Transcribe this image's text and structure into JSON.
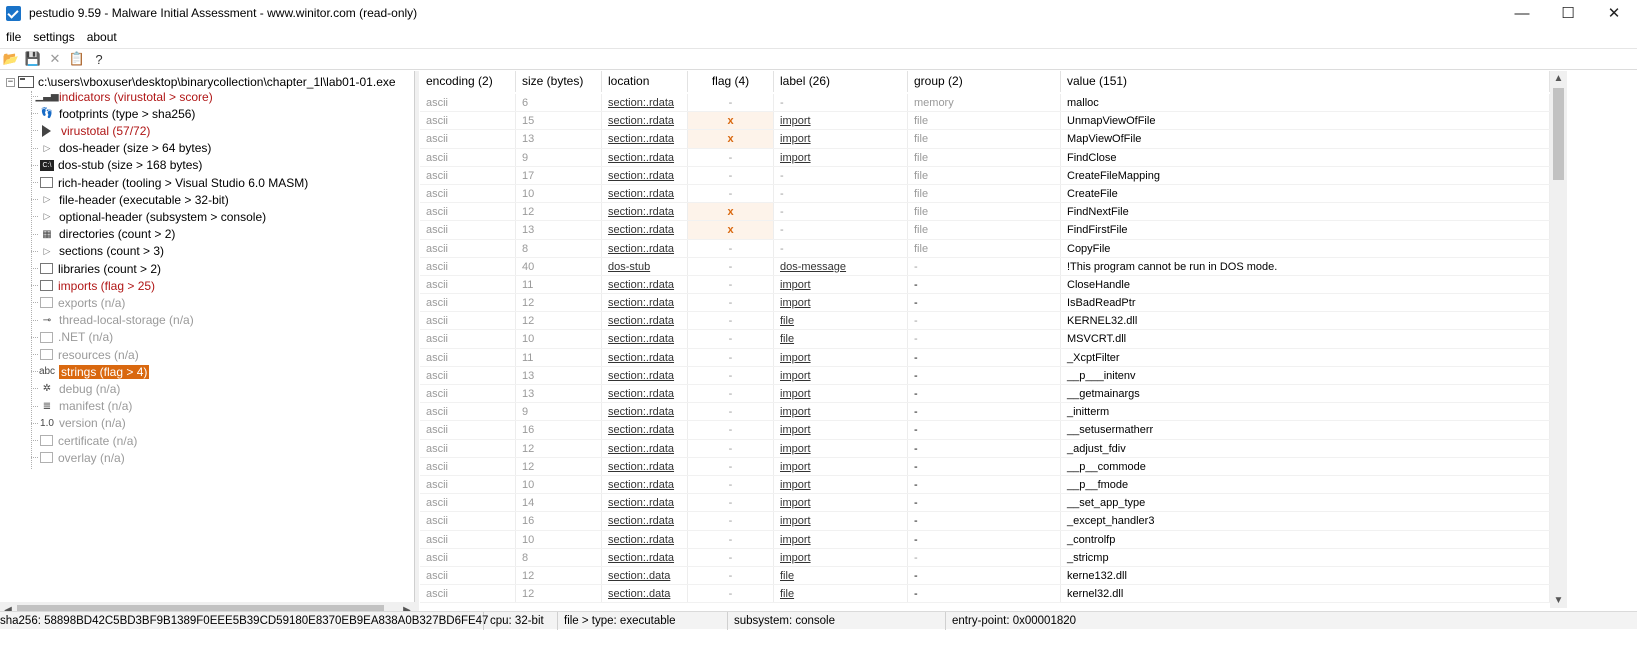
{
  "window": {
    "title": "pestudio 9.59 - Malware Initial Assessment - www.winitor.com (read-only)",
    "minimize": "—",
    "maximize": "☐",
    "close": "✕"
  },
  "menu": [
    "file",
    "settings",
    "about"
  ],
  "toolbar": {
    "open": "📂",
    "save": "💾",
    "close": "✕",
    "copy": "📋",
    "help": "?"
  },
  "tree": {
    "root_expander": "−",
    "root": "c:\\users\\vboxuser\\desktop\\binarycollection\\chapter_1l\\lab01-01.exe",
    "items": [
      {
        "label": "indicators (virustotal > score)",
        "style": "red",
        "icon": "bars-icon",
        "glyph": "▁▃▅"
      },
      {
        "label": "footprints (type > sha256)",
        "style": "normal",
        "icon": "footprints-icon",
        "glyph": "👣"
      },
      {
        "label": "virustotal (57/72)",
        "style": "red",
        "icon": "virustotal-icon",
        "glyph": ""
      },
      {
        "label": "dos-header (size > 64 bytes)",
        "style": "normal",
        "icon": "arrow-icon",
        "glyph": "▷"
      },
      {
        "label": "dos-stub (size > 168 bytes)",
        "style": "normal",
        "icon": "console-icon",
        "glyph": "C:\\"
      },
      {
        "label": "rich-header (tooling > Visual Studio 6.0 MASM)",
        "style": "normal",
        "icon": "rich-icon",
        "glyph": ""
      },
      {
        "label": "file-header (executable > 32-bit)",
        "style": "normal",
        "icon": "arrow-icon",
        "glyph": "▷"
      },
      {
        "label": "optional-header (subsystem > console)",
        "style": "normal",
        "icon": "arrow-icon",
        "glyph": "▷"
      },
      {
        "label": "directories (count > 2)",
        "style": "normal",
        "icon": "directories-icon",
        "glyph": "▦"
      },
      {
        "label": "sections (count > 3)",
        "style": "normal",
        "icon": "arrow-icon",
        "glyph": "▷"
      },
      {
        "label": "libraries (count > 2)",
        "style": "normal",
        "icon": "libraries-icon",
        "glyph": ""
      },
      {
        "label": "imports (flag > 25)",
        "style": "red",
        "icon": "imports-icon",
        "glyph": ""
      },
      {
        "label": "exports (n/a)",
        "style": "grey",
        "icon": "exports-icon",
        "glyph": ""
      },
      {
        "label": "thread-local-storage (n/a)",
        "style": "grey",
        "icon": "tls-icon",
        "glyph": "⊸"
      },
      {
        "label": ".NET (n/a)",
        "style": "grey",
        "icon": "dotnet-icon",
        "glyph": ""
      },
      {
        "label": "resources (n/a)",
        "style": "grey",
        "icon": "resources-icon",
        "glyph": ""
      },
      {
        "label": "strings (flag > 4)",
        "style": "selected",
        "icon": "strings-icon",
        "glyph": "abc"
      },
      {
        "label": "debug (n/a)",
        "style": "grey",
        "icon": "bug-icon",
        "glyph": "✲"
      },
      {
        "label": "manifest (n/a)",
        "style": "grey",
        "icon": "manifest-icon",
        "glyph": "≣"
      },
      {
        "label": "version (n/a)",
        "style": "grey",
        "icon": "version-icon",
        "glyph": "1.0"
      },
      {
        "label": "certificate (n/a)",
        "style": "grey",
        "icon": "certificate-icon",
        "glyph": ""
      },
      {
        "label": "overlay (n/a)",
        "style": "grey",
        "icon": "overlay-icon",
        "glyph": ""
      }
    ]
  },
  "table": {
    "headers": {
      "encoding": "encoding (2)",
      "size": "size (bytes)",
      "location": "location",
      "flag": "flag (4)",
      "label": "label (26)",
      "group": "group (2)",
      "value": "value (151)"
    },
    "rows": [
      {
        "encoding": "ascii",
        "size": "6",
        "location": "section:.rdata",
        "flag": "-",
        "label": "-",
        "group": "memory",
        "value": "malloc"
      },
      {
        "encoding": "ascii",
        "size": "15",
        "location": "section:.rdata",
        "flag": "x",
        "label": "import",
        "group": "file",
        "value": "UnmapViewOfFile"
      },
      {
        "encoding": "ascii",
        "size": "13",
        "location": "section:.rdata",
        "flag": "x",
        "label": "import",
        "group": "file",
        "value": "MapViewOfFile"
      },
      {
        "encoding": "ascii",
        "size": "9",
        "location": "section:.rdata",
        "flag": "-",
        "label": "import",
        "group": "file",
        "value": "FindClose"
      },
      {
        "encoding": "ascii",
        "size": "17",
        "location": "section:.rdata",
        "flag": "-",
        "label": "-",
        "group": "file",
        "value": "CreateFileMapping"
      },
      {
        "encoding": "ascii",
        "size": "10",
        "location": "section:.rdata",
        "flag": "-",
        "label": "-",
        "group": "file",
        "value": "CreateFile"
      },
      {
        "encoding": "ascii",
        "size": "12",
        "location": "section:.rdata",
        "flag": "x",
        "label": "-",
        "group": "file",
        "value": "FindNextFile"
      },
      {
        "encoding": "ascii",
        "size": "13",
        "location": "section:.rdata",
        "flag": "x",
        "label": "-",
        "group": "file",
        "value": "FindFirstFile"
      },
      {
        "encoding": "ascii",
        "size": "8",
        "location": "section:.rdata",
        "flag": "-",
        "label": "-",
        "group": "file",
        "value": "CopyFile"
      },
      {
        "encoding": "ascii",
        "size": "40",
        "location": "dos-stub",
        "flag": "-",
        "label": "dos-message",
        "group": "-",
        "value": "!This program cannot be run in DOS mode."
      },
      {
        "encoding": "ascii",
        "size": "11",
        "location": "section:.rdata",
        "flag": "-",
        "label": "import",
        "group": "-",
        "value": "CloseHandle"
      },
      {
        "encoding": "ascii",
        "size": "12",
        "location": "section:.rdata",
        "flag": "-",
        "label": "import",
        "group": "-",
        "value": "IsBadReadPtr"
      },
      {
        "encoding": "ascii",
        "size": "12",
        "location": "section:.rdata",
        "flag": "-",
        "label": "file",
        "group": "-",
        "value": "KERNEL32.dll"
      },
      {
        "encoding": "ascii",
        "size": "10",
        "location": "section:.rdata",
        "flag": "-",
        "label": "file",
        "group": "-",
        "value": "MSVCRT.dll"
      },
      {
        "encoding": "ascii",
        "size": "11",
        "location": "section:.rdata",
        "flag": "-",
        "label": "import",
        "group": "-",
        "value": "_XcptFilter"
      },
      {
        "encoding": "ascii",
        "size": "13",
        "location": "section:.rdata",
        "flag": "-",
        "label": "import",
        "group": "-",
        "value": "__p___initenv"
      },
      {
        "encoding": "ascii",
        "size": "13",
        "location": "section:.rdata",
        "flag": "-",
        "label": "import",
        "group": "-",
        "value": "__getmainargs"
      },
      {
        "encoding": "ascii",
        "size": "9",
        "location": "section:.rdata",
        "flag": "-",
        "label": "import",
        "group": "-",
        "value": "_initterm"
      },
      {
        "encoding": "ascii",
        "size": "16",
        "location": "section:.rdata",
        "flag": "-",
        "label": "import",
        "group": "-",
        "value": "__setusermatherr"
      },
      {
        "encoding": "ascii",
        "size": "12",
        "location": "section:.rdata",
        "flag": "-",
        "label": "import",
        "group": "-",
        "value": "_adjust_fdiv"
      },
      {
        "encoding": "ascii",
        "size": "12",
        "location": "section:.rdata",
        "flag": "-",
        "label": "import",
        "group": "-",
        "value": "__p__commode"
      },
      {
        "encoding": "ascii",
        "size": "10",
        "location": "section:.rdata",
        "flag": "-",
        "label": "import",
        "group": "-",
        "value": "__p__fmode"
      },
      {
        "encoding": "ascii",
        "size": "14",
        "location": "section:.rdata",
        "flag": "-",
        "label": "import",
        "group": "-",
        "value": "__set_app_type"
      },
      {
        "encoding": "ascii",
        "size": "16",
        "location": "section:.rdata",
        "flag": "-",
        "label": "import",
        "group": "-",
        "value": "_except_handler3"
      },
      {
        "encoding": "ascii",
        "size": "10",
        "location": "section:.rdata",
        "flag": "-",
        "label": "import",
        "group": "-",
        "value": "_controlfp"
      },
      {
        "encoding": "ascii",
        "size": "8",
        "location": "section:.rdata",
        "flag": "-",
        "label": "import",
        "group": "-",
        "value": "_stricmp"
      },
      {
        "encoding": "ascii",
        "size": "12",
        "location": "section:.data",
        "flag": "-",
        "label": "file",
        "group": "-",
        "value": "kerne132.dll"
      },
      {
        "encoding": "ascii",
        "size": "12",
        "location": "section:.data",
        "flag": "-",
        "label": "file",
        "group": "-",
        "value": "kernel32.dll"
      }
    ]
  },
  "status": {
    "sha256": "sha256: 58898BD42C5BD3BF9B1389F0EEE5B39CD59180E8370EB9EA838A0B327BD6FE47",
    "cpu": "cpu: 32-bit",
    "file_type": "file > type: executable",
    "subsystem": "subsystem: console",
    "entry_point": "entry-point: 0x00001820"
  },
  "colors": {
    "selected": "#d9680f",
    "flag_red": "#b01616"
  }
}
